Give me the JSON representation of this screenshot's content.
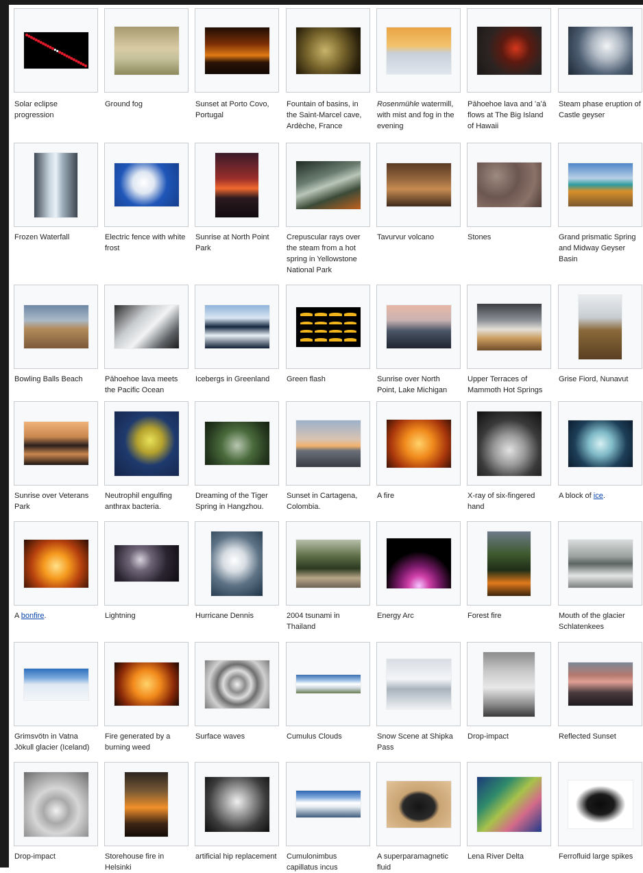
{
  "colors": {
    "frame": "#1b1b1b",
    "box_bg": "#f8f9fa",
    "box_border": "#c8ccd1",
    "text": "#202122",
    "link": "#0645ad"
  },
  "gallery": [
    {
      "caption": "Solar eclipse progression",
      "thumb": "solar-eclipse-thumbnail",
      "g": "linear-gradient(#000,#000)",
      "w": 0.78,
      "h": 0.44,
      "ov": "eclipse"
    },
    {
      "caption": "Ground fog",
      "thumb": "ground-fog-thumbnail",
      "g": "linear-gradient(180deg,#a89a70 0%,#d8cba4 45%,#c7c29c 65%,#8d8a5d 100%)",
      "w": 0.78,
      "h": 0.58
    },
    {
      "caption": "Sunset at Porto Covo, Portugal",
      "thumb": "porto-covo-sunset-thumbnail",
      "g": "linear-gradient(180deg,#1f0d05 0%,#7a2e06 35%,#e07a14 60%,#2b1306 75%,#120903 100%)",
      "w": 0.78,
      "h": 0.56
    },
    {
      "caption": "Fountain of basins, in the Saint-Marcel cave, Ardèche, France",
      "thumb": "cave-basins-thumbnail",
      "g": "radial-gradient(circle at 45% 50%,#c9b46b 0%,#7d6a2f 40%,#2e240d 80%,#150f06 100%)",
      "w": 0.78,
      "h": 0.56
    },
    {
      "caption": "watermill, with mist and fog in the evening",
      "caption_italic": "Rosenmühle",
      "thumb": "watermill-mist-thumbnail",
      "g": "linear-gradient(180deg,#e9a444 0%,#f2c36d 40%,#c9cfd8 55%,#dfe6ee 100%)",
      "w": 0.78,
      "h": 0.56
    },
    {
      "caption": "Pāhoehoe lava and ʻaʻā flows at The Big Island of Hawaii",
      "thumb": "lava-flows-thumbnail",
      "g": "radial-gradient(circle at 60% 45%,#d6371c 0%,#5c1a10 30%,#2c2422 60%,#1b1817 100%)",
      "w": 0.78,
      "h": 0.58
    },
    {
      "caption": "Steam phase eruption of Castle geyser",
      "thumb": "castle-geyser-thumbnail",
      "g": "radial-gradient(circle at 60% 40%,#f2f4f6 0%,#aeb7c2 30%,#4d5e72 60%,#1d2733 100%)",
      "w": 0.78,
      "h": 0.58
    },
    {
      "caption": "Frozen Waterfall",
      "thumb": "frozen-waterfall-thumbnail",
      "g": "linear-gradient(90deg,#3f4954 0%,#c6d3dd 35%,#e9f1f6 50%,#9fb0be 65%,#3d4650 100%)",
      "w": 0.52,
      "h": 0.78
    },
    {
      "caption": "Electric fence with white frost",
      "thumb": "frost-fence-thumbnail",
      "g": "radial-gradient(circle at 45% 45%,#ffffff 0%,#dfe7f2 25%,#1f56b8 55%,#163e8c 100%)",
      "w": 0.78,
      "h": 0.52
    },
    {
      "caption": "Sunrise at North Point Park",
      "thumb": "north-point-sunrise-thumbnail",
      "g": "linear-gradient(180deg,#3b1b2a 0%,#9a2e2a 40%,#f0692e 55%,#2b1a1f 70%,#120b10 100%)",
      "w": 0.52,
      "h": 0.78
    },
    {
      "caption": "Crepuscular rays over the steam from a hot spring in Yellowstone National Park",
      "thumb": "crepuscular-rays-thumbnail",
      "g": "linear-gradient(160deg,#1f2b23 0%,#6a7c70 35%,#b9c6b9 50%,#3b4a37 70%,#c0601e 100%)",
      "w": 0.78,
      "h": 0.58
    },
    {
      "caption": "Tavurvur volcano",
      "thumb": "tavurvur-volcano-thumbnail",
      "g": "linear-gradient(180deg,#5a3a25 0%,#9b6b3f 40%,#c78c52 60%,#3f2a1c 100%)",
      "w": 0.78,
      "h": 0.52
    },
    {
      "caption": "Stones",
      "thumb": "stones-thumbnail",
      "g": "radial-gradient(circle at 30% 30%,#9d8a80 0%,#6c5650 40%,#8a7268 70%,#4d3b36 100%)",
      "w": 0.78,
      "h": 0.54
    },
    {
      "caption": "Grand prismatic Spring and Midway Geyser Basin",
      "thumb": "grand-prismatic-thumbnail",
      "g": "linear-gradient(180deg,#4f86c8 0%,#b7d0e6 35%,#2e9c9e 50%,#d98f2a 65%,#7a5a2e 100%)",
      "w": 0.78,
      "h": 0.52
    },
    {
      "caption": "Bowling Balls Beach",
      "thumb": "bowling-balls-beach-thumbnail",
      "g": "linear-gradient(180deg,#6e87a5 0%,#aab9c8 35%,#b38b5a 55%,#7c5a3a 100%)",
      "w": 0.78,
      "h": 0.52
    },
    {
      "caption": "Pāhoehoe lava meets the Pacific Ocean",
      "thumb": "lava-ocean-thumbnail",
      "g": "linear-gradient(135deg,#2c2c2c 0%,#c9cccf 35%,#f1f3f4 55%,#5e6266 80%,#1b1b1b 100%)",
      "w": 0.78,
      "h": 0.52
    },
    {
      "caption": "Icebergs in Greenland",
      "thumb": "greenland-icebergs-thumbnail",
      "g": "linear-gradient(180deg,#8fb3d9 0%,#d9e6f2 30%,#13263e 50%,#e8f0f7 70%,#0f1e33 100%)",
      "w": 0.78,
      "h": 0.52
    },
    {
      "caption": "Green flash",
      "thumb": "green-flash-thumbnail",
      "g": "linear-gradient(#000,#000)",
      "w": 0.78,
      "h": 0.48,
      "ov": "flash"
    },
    {
      "caption": "Sunrise over North Point, Lake Michigan",
      "thumb": "lake-michigan-sunrise-thumbnail",
      "g": "linear-gradient(180deg,#e7b8a6 0%,#c9b2b2 35%,#4a5566 60%,#1f2430 100%)",
      "w": 0.78,
      "h": 0.52
    },
    {
      "caption": "Upper Terraces of Mammoth Hot Springs",
      "thumb": "mammoth-terraces-thumbnail",
      "g": "linear-gradient(180deg,#3d3f43 0%,#8a8f96 35%,#e3dfd6 55%,#c99a5c 75%,#6f4e2b 100%)",
      "w": 0.78,
      "h": 0.56
    },
    {
      "caption": "Grise Fiord, Nunavut",
      "thumb": "grise-fiord-thumbnail",
      "g": "linear-gradient(180deg,#e9ecef 0%,#c8cdd2 35%,#8a6a3a 55%,#5a3f22 100%)",
      "w": 0.52,
      "h": 0.78
    },
    {
      "caption": "Sunrise over Veterans Park",
      "thumb": "veterans-park-sunrise-thumbnail",
      "g": "linear-gradient(180deg,#f0b27a 0%,#c9874f 35%,#2a1f1d 55%,#c9874f 75%,#1d1513 100%)",
      "w": 0.78,
      "h": 0.52
    },
    {
      "caption": "Neutrophil engulfing anthrax bacteria.",
      "thumb": "neutrophil-thumbnail",
      "g": "radial-gradient(circle at 55% 45%,#e8e25a 0%,#b5a22d 25%,#1f3a6e 50%,#142448 100%)",
      "w": 0.78,
      "h": 0.78
    },
    {
      "caption": "Dreaming of the Tiger Spring in Hangzhou.",
      "thumb": "tiger-spring-thumbnail",
      "g": "radial-gradient(circle at 50% 55%,#b8c6b0 0%,#4a6b3c 40%,#26391f 75%,#14200f 100%)",
      "w": 0.78,
      "h": 0.52
    },
    {
      "caption": "Sunset in Cartagena, Colombia.",
      "thumb": "cartagena-sunset-thumbnail",
      "g": "linear-gradient(180deg,#9db1c9 0%,#d7c3b3 40%,#f2b26b 55%,#6a6f7a 65%,#3a3d44 100%)",
      "w": 0.78,
      "h": 0.56
    },
    {
      "caption": "A fire",
      "thumb": "fire-thumbnail",
      "g": "radial-gradient(circle at 50% 50%,#ffd26a 0%,#f08a1c 35%,#a8360c 70%,#3d1305 100%)",
      "w": 0.78,
      "h": 0.58
    },
    {
      "caption": "X-ray of six-fingered hand",
      "thumb": "xray-hand-thumbnail",
      "g": "radial-gradient(circle at 50% 60%,#e2e2e2 0%,#9b9b9b 30%,#3a3a3a 60%,#0f0f0f 100%)",
      "w": 0.78,
      "h": 0.78
    },
    {
      "caption": "A block of",
      "caption_link": "ice",
      "caption_tail": ".",
      "thumb": "ice-block-thumbnail",
      "g": "radial-gradient(circle at 50% 50%,#d6f1f3 0%,#7fbac7 30%,#1d3e57 65%,#0c1d2e 100%)",
      "w": 0.78,
      "h": 0.56
    },
    {
      "caption": "A",
      "caption_link": "bonfire",
      "caption_tail": ".",
      "thumb": "bonfire-thumbnail",
      "g": "radial-gradient(circle at 50% 55%,#ffe18a 0%,#f59a1e 30%,#b5400e 60%,#2a0d04 100%)",
      "w": 0.78,
      "h": 0.58
    },
    {
      "caption": "Lightning",
      "thumb": "lightning-thumbnail",
      "g": "radial-gradient(circle at 40% 40%,#d7d2dc 0%,#6f6578 25%,#2a2430 60%,#0f0c12 100%)",
      "w": 0.78,
      "h": 0.44
    },
    {
      "caption": "Hurricane Dennis",
      "thumb": "hurricane-dennis-thumbnail",
      "g": "radial-gradient(circle at 45% 45%,#ffffff 0%,#d7dde3 25%,#5e7386 55%,#1f3347 100%)",
      "w": 0.62,
      "h": 0.78
    },
    {
      "caption": "2004 tsunami in Thailand",
      "thumb": "tsunami-thumbnail",
      "g": "linear-gradient(180deg,#b7bfa9 0%,#5c6c45 35%,#2c3a22 60%,#b8a889 80%,#6d6152 100%)",
      "w": 0.78,
      "h": 0.58
    },
    {
      "caption": "Energy Arc",
      "thumb": "energy-arc-thumbnail",
      "g": "radial-gradient(circle at 50% 95%,#f4c6ff 0%,#d040a8 18%,#7a1a6a 35%,#000 60%)",
      "w": 0.78,
      "h": 0.6
    },
    {
      "caption": "Forest fire",
      "thumb": "forest-fire-thumbnail",
      "g": "linear-gradient(180deg,#6d7a8a 0%,#3f5a2e 35%,#1f2d17 60%,#e07a1b 80%,#3b250d 100%)",
      "w": 0.52,
      "h": 0.78
    },
    {
      "caption": "Mouth of the glacier Schlatenkees",
      "thumb": "glacier-mouth-thumbnail",
      "g": "linear-gradient(180deg,#d9dcdc 0%,#9aa19e 35%,#5c6562 50%,#e3e6e4 75%,#7d8280 100%)",
      "w": 0.78,
      "h": 0.58
    },
    {
      "caption": "Grimsvötn in Vatna Jökull glacier (Iceland)",
      "thumb": "grimsvotn-thumbnail",
      "g": "linear-gradient(180deg,#2c6ebd 0%,#7aa9dc 30%,#dfe9f3 50%,#f3f6f9 100%)",
      "w": 0.78,
      "h": 0.38
    },
    {
      "caption": "Fire generated by a burning weed",
      "thumb": "burning-weed-thumbnail",
      "g": "radial-gradient(circle at 50% 50%,#ffd36b 0%,#f28a1c 35%,#8a2a08 70%,#1a0702 100%)",
      "w": 0.78,
      "h": 0.52
    },
    {
      "caption": "Surface waves",
      "thumb": "surface-waves-thumbnail",
      "g": "radial-gradient(circle at 50% 50%,#f2f2f2 0%,#8c8c8c 20%,#dcdcdc 35%,#6e6e6e 50%,#d0d0d0 70%,#7b7b7b 100%)",
      "w": 0.78,
      "h": 0.58
    },
    {
      "caption": "Cumulus Clouds",
      "thumb": "cumulus-clouds-thumbnail",
      "g": "linear-gradient(180deg,#3b6fb0 0%,#9cc0e6 30%,#ffffff 50%,#d1d9e1 70%,#6a7d52 100%)",
      "w": 0.78,
      "h": 0.22
    },
    {
      "caption": "Snow Scene at Shipka Pass",
      "thumb": "shipka-pass-thumbnail",
      "g": "linear-gradient(180deg,#d9dde4 0%,#f3f5f8 40%,#aab3bd 60%,#eef1f4 100%)",
      "w": 0.78,
      "h": 0.6
    },
    {
      "caption": "Drop-impact",
      "thumb": "drop-impact-glass-thumbnail",
      "g": "linear-gradient(180deg,#8c8c8c 0%,#c9c9c9 30%,#e8e8e8 55%,#8f8f8f 80%,#3a3a3a 100%)",
      "w": 0.62,
      "h": 0.78
    },
    {
      "caption": "Reflected Sunset",
      "thumb": "reflected-sunset-thumbnail",
      "g": "linear-gradient(180deg,#7c8796 0%,#b5796e 30%,#e0a095 45%,#4a3b3f 70%,#1f1a1d 100%)",
      "w": 0.78,
      "h": 0.52
    },
    {
      "caption": "Drop-impact",
      "thumb": "drop-impact-water-thumbnail",
      "g": "radial-gradient(circle at 50% 60%,#f2f2f2 0%,#a9a9a9 25%,#d6d6d6 45%,#6b6b6b 100%)",
      "w": 0.78,
      "h": 0.78
    },
    {
      "caption": "Storehouse fire in Helsinki",
      "thumb": "helsinki-fire-thumbnail",
      "g": "linear-gradient(180deg,#2b241f 0%,#7a5a35 30%,#f0902a 55%,#3d2514 80%,#120c08 100%)",
      "w": 0.52,
      "h": 0.78
    },
    {
      "caption": "artificial hip replacement",
      "thumb": "hip-xray-thumbnail",
      "g": "radial-gradient(circle at 50% 45%,#f0f0f0 0%,#9d9d9d 30%,#3c3c3c 65%,#0d0d0d 100%)",
      "w": 0.78,
      "h": 0.66
    },
    {
      "caption": "Cumulonimbus capillatus incus",
      "thumb": "cumulonimbus-thumbnail",
      "g": "linear-gradient(180deg,#2f66b3 0%,#7fa9dc 25%,#ffffff 45%,#e7edf3 60%,#3f5d7e 100%)",
      "w": 0.78,
      "h": 0.32
    },
    {
      "caption": "A superparamagnetic fluid",
      "thumb": "superparamagnetic-fluid-thumbnail",
      "g": "radial-gradient(ellipse at 50% 55%,#151515 0%,#2a2a2a 35%,#c9a372 45%,#e2c39a 100%)",
      "w": 0.78,
      "h": 0.56
    },
    {
      "caption": "Lena River Delta",
      "thumb": "lena-delta-thumbnail",
      "g": "linear-gradient(135deg,#1c3b7a 0%,#2f8a6b 30%,#a7c24a 50%,#d46b8a 70%,#1f3a8a 100%)",
      "w": 0.78,
      "h": 0.66
    },
    {
      "caption": "Ferrofluid large spikes",
      "thumb": "ferrofluid-spikes-thumbnail",
      "g": "radial-gradient(ellipse at 50% 50%,#0b0b0b 0%,#1b1b1b 30%,#ffffff 55%)",
      "w": 0.78,
      "h": 0.58
    }
  ]
}
